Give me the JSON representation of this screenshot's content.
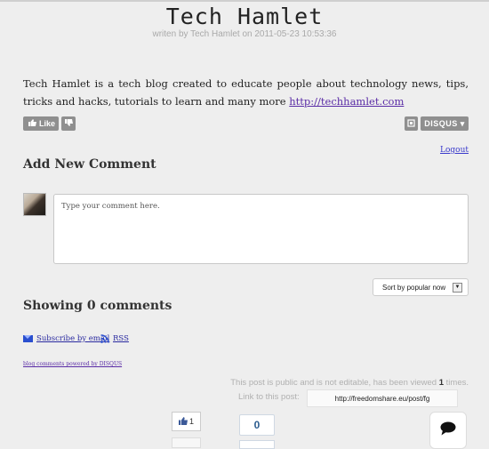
{
  "post": {
    "title": "Tech Hamlet",
    "byline": "writen by Tech Hamlet on 2011-05-23 10:53:36",
    "body_text": "Tech Hamlet is a tech blog created to educate people about technology news, tips, tricks and hacks, tutorials to learn and many more",
    "body_link": "http://techhamlet.com"
  },
  "actions": {
    "like_label": "Like",
    "disqus_label": "DISQUS ▾",
    "logout_label": "Logout"
  },
  "comments": {
    "add_heading": "Add New Comment",
    "placeholder": "Type your comment here.",
    "sort_label": "Sort by popular now",
    "showing": "Showing 0 comments",
    "subscribe_email": "Subscribe by email",
    "rss": "RSS",
    "powered_by": "blog comments powered by DISQUS"
  },
  "footer": {
    "public_prefix": "This post is public and is not editable, has been viewed",
    "view_count": "1",
    "public_suffix": "times.",
    "link_label": "Link to this post:",
    "link_value": "http://freedomshare.eu/post/fg",
    "fb_like_count": "1",
    "share_count": "0"
  },
  "colors": {
    "background": "#eeeeee",
    "button_grey": "#8f8f8f",
    "link_purple": "#5a2ca6",
    "counter_blue": "#2c5d8f"
  },
  "icons": [
    "thumbs-up-icon",
    "thumbs-down-icon",
    "reaction-icon",
    "mail-icon",
    "rss-icon",
    "chat-bubble-icon"
  ]
}
